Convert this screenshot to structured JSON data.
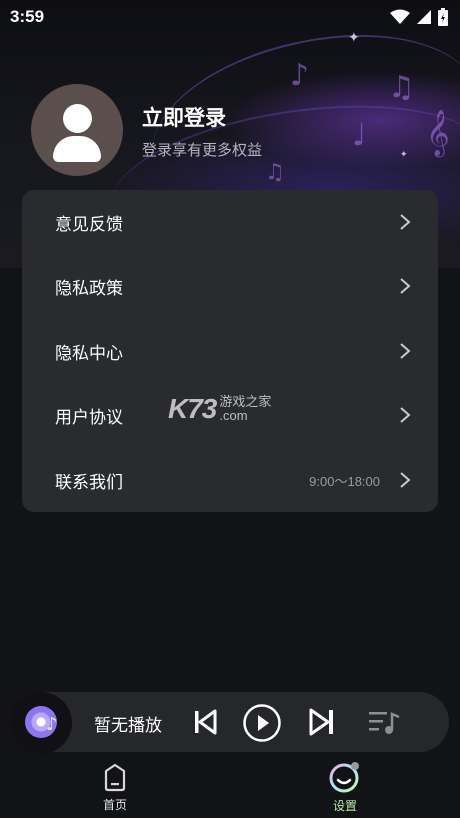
{
  "status_bar": {
    "time": "3:59"
  },
  "profile": {
    "title": "立即登录",
    "subtitle": "登录享有更多权益"
  },
  "menu": [
    {
      "label": "意见反馈",
      "extra": ""
    },
    {
      "label": "隐私政策",
      "extra": ""
    },
    {
      "label": "隐私中心",
      "extra": ""
    },
    {
      "label": "用户协议",
      "extra": ""
    },
    {
      "label": "联系我们",
      "extra": "9:00～18:00"
    }
  ],
  "watermark": {
    "logo": "K73",
    "name": "游戏之家",
    "domain": ".com"
  },
  "player": {
    "title": "暂无播放"
  },
  "nav": {
    "home_label": "首页",
    "settings_label": "设置"
  },
  "colors": {
    "background": "#121317",
    "card": "#292b2e",
    "player_bg": "#25272a",
    "settings_accent": "#b5f0a8",
    "disc_accent": "#8d74f0"
  },
  "icons": {
    "status": [
      "wifi-icon",
      "signal-icon",
      "battery-icon"
    ],
    "menu_chevron": "chevron-right-icon",
    "player": [
      "disc-icon",
      "previous-icon",
      "play-icon",
      "next-icon",
      "playlist-icon"
    ],
    "nav": [
      "home-icon",
      "settings-icon"
    ]
  }
}
